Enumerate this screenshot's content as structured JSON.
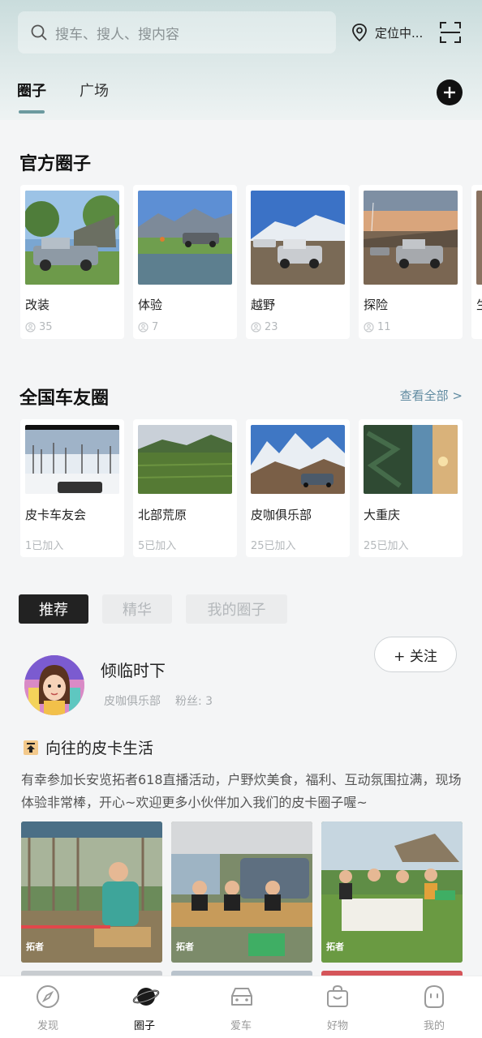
{
  "header": {
    "search_placeholder": "搜车、搜人、搜内容",
    "location_text": "定位中...",
    "tabs": [
      {
        "label": "圈子",
        "active": true
      },
      {
        "label": "广场",
        "active": false
      }
    ]
  },
  "official": {
    "title": "官方圈子",
    "items": [
      {
        "name": "改装",
        "count": "35"
      },
      {
        "name": "体验",
        "count": "7"
      },
      {
        "name": "越野",
        "count": "23"
      },
      {
        "name": "探险",
        "count": "11"
      },
      {
        "name": "生",
        "count": ""
      }
    ]
  },
  "national": {
    "title": "全国车友圈",
    "see_all": "查看全部 >",
    "items": [
      {
        "name": "皮卡车友会",
        "joined": "1已加入"
      },
      {
        "name": "北部荒原",
        "joined": "5已加入"
      },
      {
        "name": "皮咖俱乐部",
        "joined": "25已加入"
      },
      {
        "name": "大重庆",
        "joined": "25已加入"
      }
    ]
  },
  "filters": [
    "推荐",
    "精华",
    "我的圈子"
  ],
  "post": {
    "user": "倾临时下",
    "club": "皮咖俱乐部",
    "fans": "粉丝: 3",
    "follow_label": "+ 关注",
    "title": "向往的皮卡生活",
    "body": "有幸参加长安览拓者618直播活动，户野炊美食，福利、互动氛围拉满，现场体验非常棒，开心~欢迎更多小伙伴加入我们的皮卡圈子喔~",
    "photo_tag": "拓者"
  },
  "bottom_nav": [
    {
      "label": "发现",
      "icon": "compass-icon"
    },
    {
      "label": "圈子",
      "icon": "planet-icon",
      "active": true
    },
    {
      "label": "爱车",
      "icon": "car-icon"
    },
    {
      "label": "好物",
      "icon": "shopping-bag-icon"
    },
    {
      "label": "我的",
      "icon": "profile-icon"
    }
  ],
  "colors": {
    "accent": "#6b9a9f",
    "link": "#5f8aa0",
    "dark": "#222222"
  }
}
